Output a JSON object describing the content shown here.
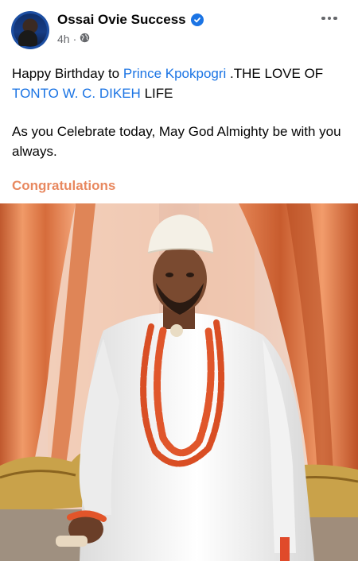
{
  "post": {
    "author": "Ossai Ovie Success",
    "time": "4h",
    "separator": "·",
    "text": {
      "line1_pre": "Happy Birthday to ",
      "line1_link": "Prince Kpokpogri",
      "line1_post": " .THE LOVE OF",
      "line2_link": "TONTO W. C. DIKEH",
      "line2_post": "  LIFE",
      "para2": "As you Celebrate today, May God Almighty be with you always."
    },
    "hashtag": "Congratulations"
  },
  "icons": {
    "verified": "verified-badge-icon",
    "privacy": "globe-icon",
    "more": "more-options-icon"
  },
  "colors": {
    "link": "#1b74e4",
    "hashtag": "#e8885f",
    "verified": "#1b74e4",
    "meta": "#65676b"
  }
}
